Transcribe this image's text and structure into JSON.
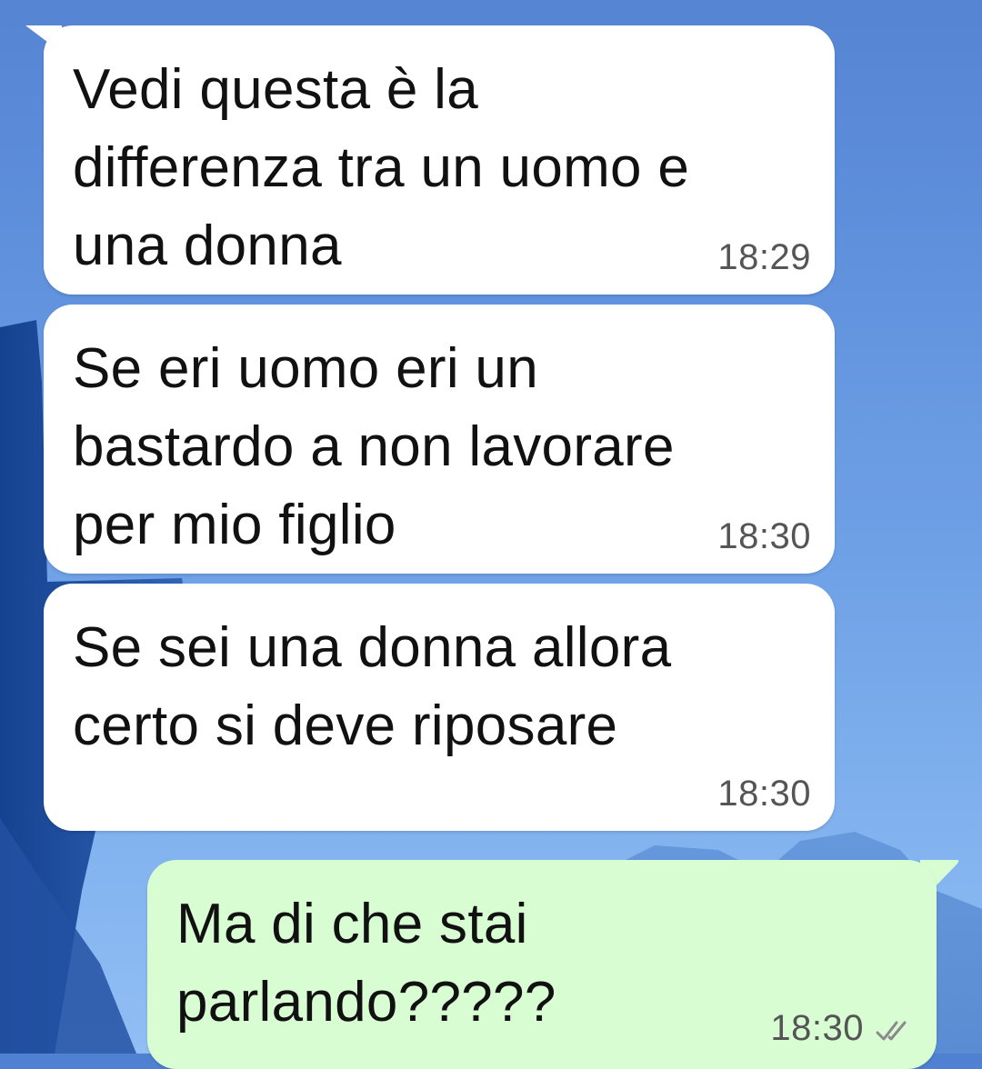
{
  "chat": {
    "messages": [
      {
        "direction": "incoming",
        "text": "Vedi questa è la\ndifferenza tra un uomo e\nuna donna",
        "time": "18:29"
      },
      {
        "direction": "incoming",
        "text": "Se eri uomo eri un\nbastardo a non lavorare\nper mio figlio",
        "time": "18:30"
      },
      {
        "direction": "incoming",
        "text": "Se sei una donna allora\ncerto si deve riposare",
        "time": "18:30"
      },
      {
        "direction": "outgoing",
        "text": "Ma di che stai\nparlando?????",
        "time": "18:30",
        "status_icon": "double-check-icon"
      }
    ]
  },
  "colors": {
    "incoming_bubble": "#ffffff",
    "outgoing_bubble": "#d8fdd2",
    "timestamp": "#555555",
    "wallpaper": "#5a8ddc"
  }
}
